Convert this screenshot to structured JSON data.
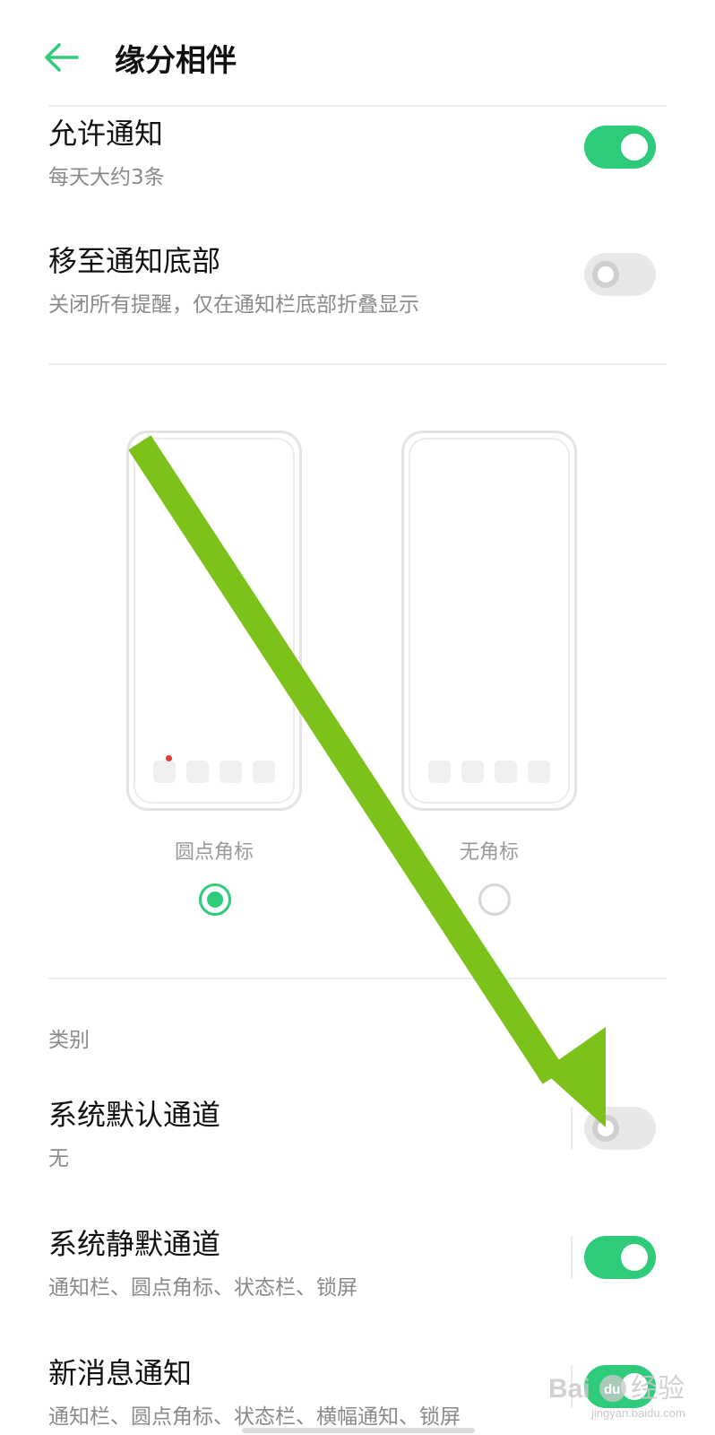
{
  "header": {
    "title": "缘分相伴",
    "back_icon": "arrow-left-icon"
  },
  "settings": {
    "allow_notifications": {
      "title": "允许通知",
      "subtitle": "每天大约3条",
      "enabled": true
    },
    "move_to_bottom": {
      "title": "移至通知底部",
      "subtitle": "关闭所有提醒，仅在通知栏底部折叠显示",
      "enabled": false
    }
  },
  "badge_options": [
    {
      "label": "圆点角标",
      "selected": true
    },
    {
      "label": "无角标",
      "selected": false
    }
  ],
  "category": {
    "heading": "类别",
    "items": [
      {
        "title": "系统默认通道",
        "subtitle": "无",
        "enabled": false
      },
      {
        "title": "系统静默通道",
        "subtitle": "通知栏、圆点角标、状态栏、锁屏",
        "enabled": true
      },
      {
        "title": "新消息通知",
        "subtitle": "通知栏、圆点角标、状态栏、横幅通知、锁屏",
        "enabled": true
      }
    ]
  },
  "watermark": {
    "text": "Bai du 经验",
    "url_text": "jingyan.baidu.com"
  },
  "colors": {
    "accent": "#2ecc7a",
    "arrow": "#7cc21b",
    "badge_dot": "#e53935"
  }
}
